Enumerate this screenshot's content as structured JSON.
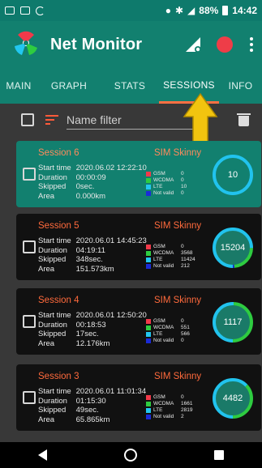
{
  "status_bar": {
    "battery": "88%",
    "time": "14:42"
  },
  "app": {
    "title": "Net Monitor"
  },
  "tabs": [
    {
      "label": "MAIN"
    },
    {
      "label": "GRAPH"
    },
    {
      "label": "STATS"
    },
    {
      "label": "SESSIONS",
      "active": true
    },
    {
      "label": "INFO"
    }
  ],
  "filter": {
    "placeholder": "Name filter"
  },
  "labels": {
    "start_time": "Start time",
    "duration": "Duration",
    "skipped": "Skipped",
    "area": "Area"
  },
  "tech_labels": {
    "gsm": "GSM",
    "wcdma": "WCDMA",
    "lte": "LTE",
    "not_valid": "Not valid"
  },
  "colors": {
    "gsm": "#f2394a",
    "wcdma": "#2ecc40",
    "lte": "#22c7f0",
    "not_valid": "#1a2bd8",
    "accent": "#ff6a3c",
    "ring_lte": "#21c3ee",
    "ring_wcdma": "#2ecc40"
  },
  "sessions": [
    {
      "name": "Session 6",
      "sim": "SIM Skinny",
      "start_time": "2020.06.02 12:22:10",
      "duration": "00:00:09",
      "skipped": "0sec.",
      "area": "0.000km",
      "gsm": "0",
      "wcdma": "0",
      "lte": "10",
      "not_valid": "0",
      "total": "10",
      "selected": true
    },
    {
      "name": "Session 5",
      "sim": "SIM Skinny",
      "start_time": "2020.06.01 14:45:23",
      "duration": "04:19:11",
      "skipped": "348sec.",
      "area": "151.573km",
      "gsm": "0",
      "wcdma": "3568",
      "lte": "11424",
      "not_valid": "212",
      "total": "15204",
      "selected": false
    },
    {
      "name": "Session 4",
      "sim": "SIM Skinny",
      "start_time": "2020.06.01 12:50:20",
      "duration": "00:18:53",
      "skipped": "17sec.",
      "area": "12.176km",
      "gsm": "0",
      "wcdma": "551",
      "lte": "566",
      "not_valid": "0",
      "total": "1117",
      "selected": false
    },
    {
      "name": "Session 3",
      "sim": "SIM Skinny",
      "start_time": "2020.06.01 11:01:34",
      "duration": "01:15:30",
      "skipped": "49sec.",
      "area": "65.865km",
      "gsm": "0",
      "wcdma": "1661",
      "lte": "2819",
      "not_valid": "2",
      "total": "4482",
      "selected": false
    }
  ]
}
